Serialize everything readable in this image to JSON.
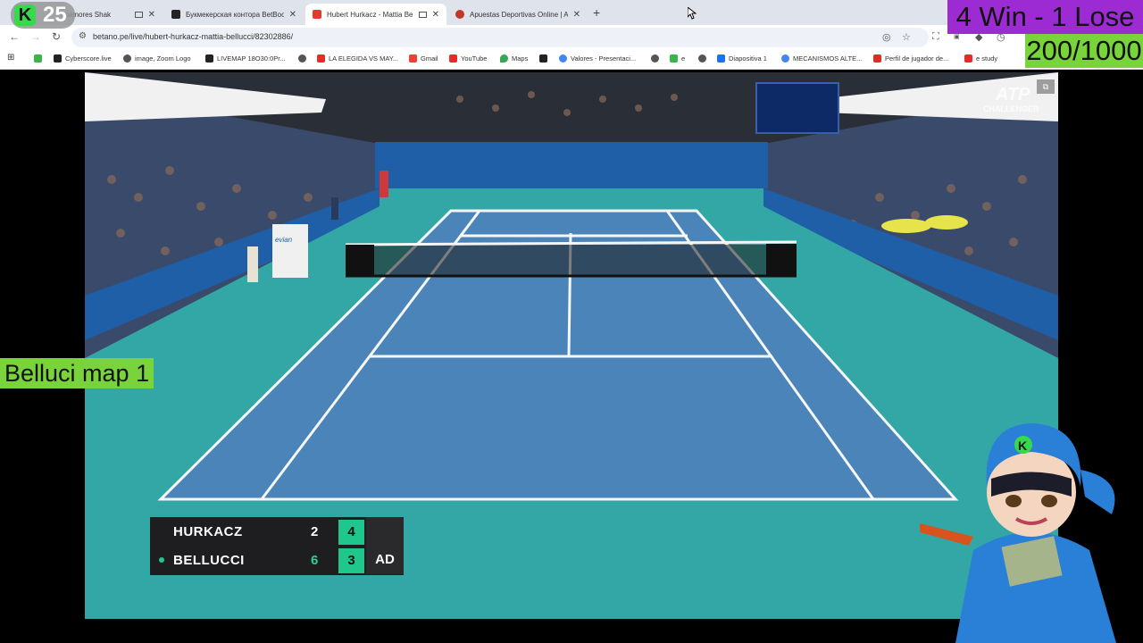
{
  "tabs": [
    {
      "title": "enamores Shak",
      "active": false
    },
    {
      "title": "Букмекерская контора BetBoo",
      "active": false
    },
    {
      "title": "Hubert Hurkacz - Mattia Be",
      "active": true
    },
    {
      "title": "Apuestas Deportivas Online | A",
      "active": false
    }
  ],
  "address_bar": {
    "url": "betano.pe/live/hubert-hurkacz-mattia-bellucci/82302886/"
  },
  "bookmarks": [
    "Cyberscore.live",
    "image, Zoom Logo",
    "LIVEMAP 18O30:0Pr...",
    "",
    "LA ELEGIDA VS MAY...",
    "Gmail",
    "YouTube",
    "Maps",
    "",
    "Valores - Presentaci...",
    "",
    "e",
    "",
    "Diapositiva 1",
    "MECANISMOS ALTE...",
    "Perfil de jugador de...",
    "e study"
  ],
  "scoreboard": {
    "players": [
      {
        "name": "HURKACZ",
        "sets": "2",
        "games": "4",
        "points": "",
        "serving": false
      },
      {
        "name": "BELLUCCI",
        "sets": "6",
        "games": "3",
        "points": "AD",
        "serving": true
      }
    ]
  },
  "video_overlay": {
    "atp_logo": "ATP",
    "atp_sub": "CHALLENGER",
    "sponsor_banner": "evian"
  },
  "stream_overlay": {
    "kick_count": "25",
    "kick_logo": "K",
    "record_line1": "4 Win - 1 Lose",
    "record_line2": "200/1000",
    "map_label": "Belluci map 1"
  },
  "colors": {
    "court_inner": "#4a84b8",
    "court_outer": "#33a7a5",
    "scoreboard_accent": "#1fc78c",
    "record_bg": "#9c2bd4",
    "label_bg": "#79d43b"
  }
}
